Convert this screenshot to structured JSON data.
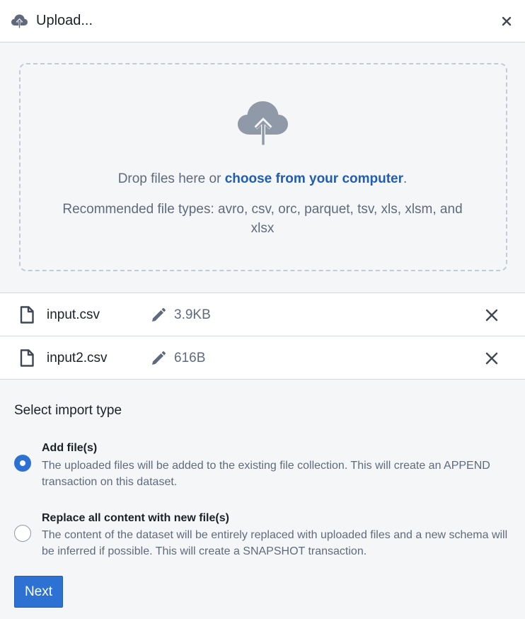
{
  "dialog": {
    "title": "Upload...",
    "close_icon": "close-icon",
    "header_icon": "cloud-upload-icon"
  },
  "dropzone": {
    "icon": "cloud-upload-icon",
    "drop_text": "Drop files here or ",
    "link_text": "choose from your computer",
    "drop_text_end": ".",
    "recommended": "Recommended file types: avro, csv, orc, parquet, tsv, xls, xlsm, and xlsx"
  },
  "files": [
    {
      "name": "input.csv",
      "size": "3.9KB",
      "icon": "file-icon",
      "edit_icon": "edit-icon",
      "remove_icon": "close-icon"
    },
    {
      "name": "input2.csv",
      "size": "616B",
      "icon": "file-icon",
      "edit_icon": "edit-icon",
      "remove_icon": "close-icon"
    }
  ],
  "import_type": {
    "label": "Select import type",
    "options": [
      {
        "title": "Add file(s)",
        "description": "The uploaded files will be added to the existing file collection. This will create an APPEND transaction on this dataset.",
        "selected": true
      },
      {
        "title": "Replace all content with new file(s)",
        "description": "The content of the dataset will be entirely replaced with uploaded files and a new schema will be inferred if possible. This will create a SNAPSHOT transaction.",
        "selected": false
      }
    ]
  },
  "footer": {
    "next_label": "Next"
  },
  "colors": {
    "accent": "#2d72d2",
    "link": "#215db0",
    "muted_text": "#5f6b7c",
    "icon_gray": "#8f99a8"
  }
}
